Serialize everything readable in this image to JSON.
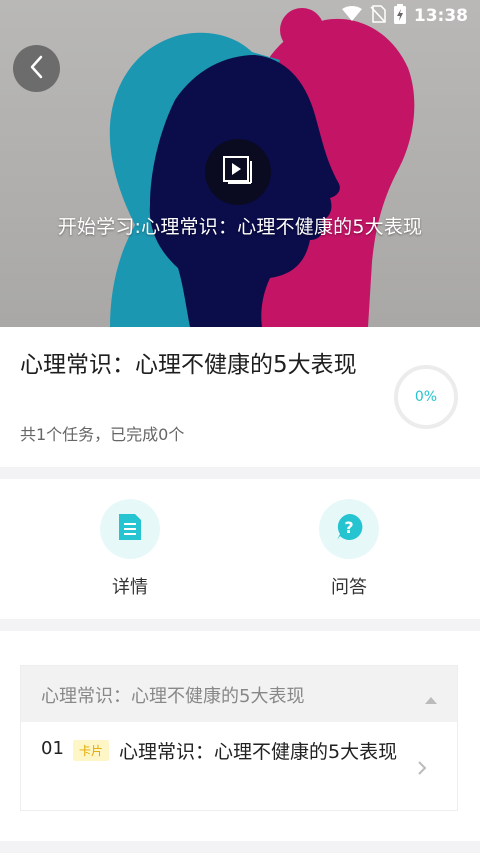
{
  "status_bar": {
    "time": "13:38"
  },
  "hero": {
    "caption": "开始学习:心理常识：心理不健康的5大表现"
  },
  "course": {
    "title": "心理常识：心理不健康的5大表现",
    "subtitle": "共1个任务，已完成0个",
    "progress_label": "0%",
    "progress": 0
  },
  "actions": [
    {
      "label": "详情",
      "icon": "document-icon"
    },
    {
      "label": "问答",
      "icon": "question-icon"
    }
  ],
  "lesson_group": {
    "title": "心理常识：心理不健康的5大表现",
    "items": [
      {
        "number": "01",
        "tag": "卡片",
        "title": "心理常识：心理不健康的5大表现"
      }
    ]
  },
  "colors": {
    "accent": "#25c4d0",
    "tag_bg": "#fff6c8",
    "tag_text": "#e0a800"
  }
}
